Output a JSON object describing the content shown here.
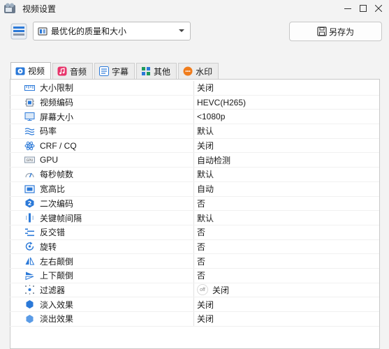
{
  "window": {
    "title": "视频设置",
    "controls": [
      "minimize",
      "maximize",
      "close"
    ]
  },
  "preset": {
    "selected": "最优化的质量和大小",
    "save_as_label": "另存为"
  },
  "tabs": [
    {
      "label": "视频",
      "icon": "video-icon",
      "active": true
    },
    {
      "label": "音频",
      "icon": "music-icon",
      "active": false
    },
    {
      "label": "字幕",
      "icon": "subtitle-icon",
      "active": false
    },
    {
      "label": "其他",
      "icon": "grid-icon",
      "active": false
    },
    {
      "label": "水印",
      "icon": "watermark-icon",
      "active": false
    }
  ],
  "settings": [
    {
      "name": "大小限制",
      "value": "关闭",
      "icon": "ruler-icon"
    },
    {
      "name": "视频编码",
      "value": "HEVC(H265)",
      "icon": "chip-icon"
    },
    {
      "name": "屏幕大小",
      "value": "<1080p",
      "icon": "monitor-icon"
    },
    {
      "name": "码率",
      "value": "默认",
      "icon": "waves-icon"
    },
    {
      "name": "CRF / CQ",
      "value": "关闭",
      "icon": "atom-icon"
    },
    {
      "name": "GPU",
      "value": "自动检测",
      "icon": "gpu-icon"
    },
    {
      "name": "每秒帧数",
      "value": "默认",
      "icon": "speedometer-icon"
    },
    {
      "name": "宽高比",
      "value": "自动",
      "icon": "aspect-ratio-icon"
    },
    {
      "name": "二次编码",
      "value": "否",
      "icon": "two-pass-icon"
    },
    {
      "name": "关键帧间隔",
      "value": "默认",
      "icon": "keyframe-icon"
    },
    {
      "name": "反交错",
      "value": "否",
      "icon": "deinterlace-icon"
    },
    {
      "name": "旋转",
      "value": "否",
      "icon": "rotate-icon"
    },
    {
      "name": "左右颠倒",
      "value": "否",
      "icon": "flip-horizontal-icon"
    },
    {
      "name": "上下颠倒",
      "value": "否",
      "icon": "flip-vertical-icon"
    },
    {
      "name": "过滤器",
      "value": "关闭",
      "icon": "filter-icon",
      "badge": "off"
    },
    {
      "name": "淡入效果",
      "value": "关闭",
      "icon": "fade-in-icon"
    },
    {
      "name": "淡出效果",
      "value": "关闭",
      "icon": "fade-out-icon"
    }
  ],
  "colors": {
    "accent": "#2b79d8",
    "window_bg": "#f3f3f3",
    "panel_bg": "#ffffff",
    "music_tab": "#e8356b",
    "watermark_tab": "#f07c1c"
  }
}
